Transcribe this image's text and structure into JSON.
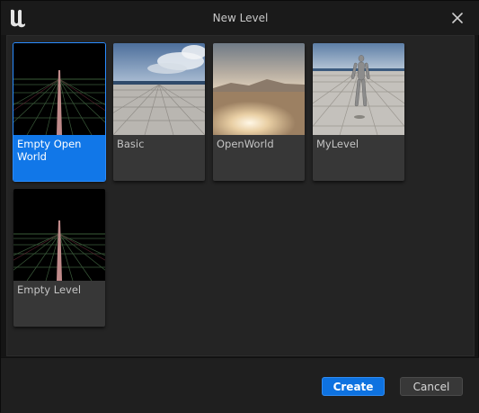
{
  "window": {
    "title": "New Level",
    "logo_icon": "unreal-engine-logo-icon",
    "close_icon": "close-icon"
  },
  "templates": [
    {
      "label": "Empty Open World",
      "thumbnail": "grid-perspective",
      "selected": true
    },
    {
      "label": "Basic",
      "thumbnail": "sky-checker-floor",
      "selected": false
    },
    {
      "label": "OpenWorld",
      "thumbnail": "sunset-sand",
      "selected": false
    },
    {
      "label": "MyLevel",
      "thumbnail": "mannequin-checker-floor",
      "selected": false
    },
    {
      "label": "Empty Level",
      "thumbnail": "grid-perspective",
      "selected": false
    }
  ],
  "buttons": {
    "create": "Create",
    "cancel": "Cancel"
  },
  "colors": {
    "accent": "#0e72e0",
    "selected_tile": "#1177e8",
    "tile": "#373737",
    "background": "#242424"
  }
}
